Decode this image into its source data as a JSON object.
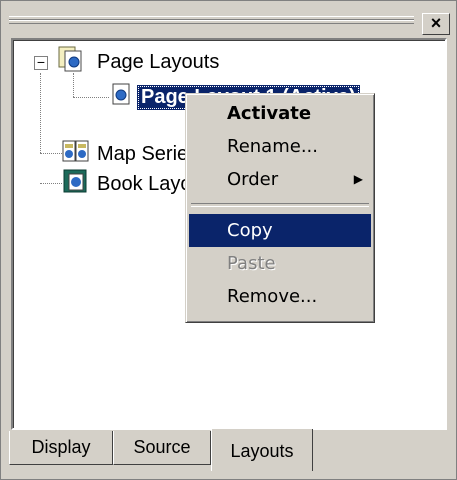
{
  "tree": {
    "root_label": "Page Layouts",
    "root_expander": "−",
    "selected_item": "Page Layout 1 (Active)",
    "map_series_label": "Map Series",
    "book_layout_label": "Book Layouts"
  },
  "close_label": "×",
  "context_menu": {
    "items": [
      {
        "label": "Activate",
        "state": "bold"
      },
      {
        "label": "Rename...",
        "state": "normal"
      },
      {
        "label": "Order",
        "state": "submenu"
      },
      {
        "label": "Copy",
        "state": "highlighted"
      },
      {
        "label": "Paste",
        "state": "disabled"
      },
      {
        "label": "Remove...",
        "state": "normal"
      }
    ],
    "submenu_arrow": "▶"
  },
  "tabs": [
    {
      "label": "Display",
      "active": false
    },
    {
      "label": "Source",
      "active": false
    },
    {
      "label": "Layouts",
      "active": true
    }
  ],
  "colors": {
    "selection": "#0a246a",
    "face": "#d4d0c8"
  }
}
